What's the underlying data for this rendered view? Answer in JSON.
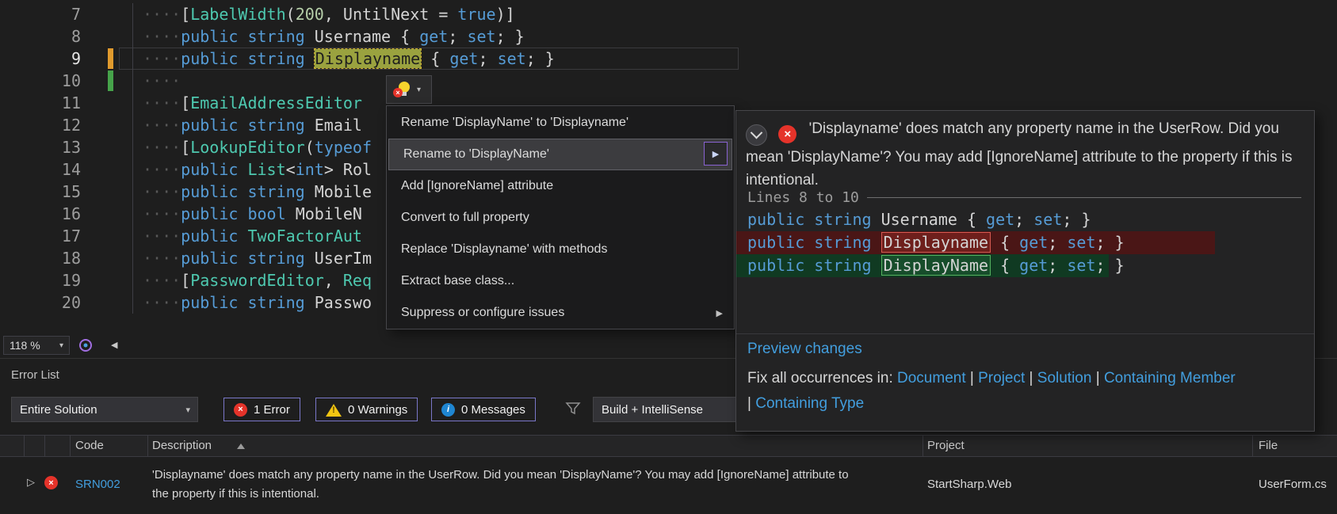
{
  "icons": {
    "dropdown_caret": "▾",
    "submenu_arrow": "▶",
    "scroll_left_arrow": "◀",
    "row_expander": "▷",
    "error_x": "×",
    "warning_mark": "!",
    "info_mark": "i"
  },
  "colors": {
    "accent_link": "#429ede",
    "error_red": "#e5332a",
    "warning_yellow": "#f2c512",
    "info_blue": "#1f86d2",
    "removed_line_bg": "#4a1616",
    "added_line_bg": "#103a22"
  },
  "editor": {
    "zoom_label": "118 %",
    "lines": [
      {
        "num": "7",
        "tokens": [
          [
            "ws",
            "····"
          ],
          [
            "p",
            "["
          ],
          [
            "t",
            "LabelWidth"
          ],
          [
            "p",
            "("
          ],
          [
            "n",
            "200"
          ],
          [
            "p",
            ", "
          ],
          [
            "i",
            "UntilNext"
          ],
          [
            "p",
            " = "
          ],
          [
            "k",
            "true"
          ],
          [
            "p",
            ")]"
          ]
        ]
      },
      {
        "num": "8",
        "tokens": [
          [
            "ws",
            "····"
          ],
          [
            "k",
            "public"
          ],
          [
            "p",
            " "
          ],
          [
            "k",
            "string"
          ],
          [
            "p",
            " "
          ],
          [
            "i",
            "Username"
          ],
          [
            "p",
            " { "
          ],
          [
            "k",
            "get"
          ],
          [
            "p",
            "; "
          ],
          [
            "k",
            "set"
          ],
          [
            "p",
            "; }"
          ]
        ]
      },
      {
        "num": "9",
        "current": true,
        "marker": "modified",
        "tokens": [
          [
            "ws",
            "····"
          ],
          [
            "k",
            "public"
          ],
          [
            "p",
            " "
          ],
          [
            "k",
            "string"
          ],
          [
            "p",
            " "
          ],
          [
            "hl",
            "Displayname"
          ],
          [
            "p",
            " { "
          ],
          [
            "k",
            "get"
          ],
          [
            "p",
            "; "
          ],
          [
            "k",
            "set"
          ],
          [
            "p",
            "; }"
          ]
        ]
      },
      {
        "num": "10",
        "marker": "saved",
        "tokens": [
          [
            "ws",
            "····"
          ]
        ]
      },
      {
        "num": "11",
        "tokens": [
          [
            "ws",
            "····"
          ],
          [
            "p",
            "["
          ],
          [
            "t",
            "EmailAddressEditor"
          ]
        ]
      },
      {
        "num": "12",
        "tokens": [
          [
            "ws",
            "····"
          ],
          [
            "k",
            "public"
          ],
          [
            "p",
            " "
          ],
          [
            "k",
            "string"
          ],
          [
            "p",
            " "
          ],
          [
            "i",
            "Email"
          ]
        ]
      },
      {
        "num": "13",
        "tokens": [
          [
            "ws",
            "····"
          ],
          [
            "p",
            "["
          ],
          [
            "t",
            "LookupEditor"
          ],
          [
            "p",
            "("
          ],
          [
            "k",
            "typeof"
          ]
        ]
      },
      {
        "num": "14",
        "tokens": [
          [
            "ws",
            "····"
          ],
          [
            "k",
            "public"
          ],
          [
            "p",
            " "
          ],
          [
            "t",
            "List"
          ],
          [
            "p",
            "<"
          ],
          [
            "k",
            "int"
          ],
          [
            "p",
            "> "
          ],
          [
            "i",
            "Rol"
          ]
        ]
      },
      {
        "num": "15",
        "tokens": [
          [
            "ws",
            "····"
          ],
          [
            "k",
            "public"
          ],
          [
            "p",
            " "
          ],
          [
            "k",
            "string"
          ],
          [
            "p",
            " "
          ],
          [
            "i",
            "Mobile"
          ]
        ]
      },
      {
        "num": "16",
        "tokens": [
          [
            "ws",
            "····"
          ],
          [
            "k",
            "public"
          ],
          [
            "p",
            " "
          ],
          [
            "k",
            "bool"
          ],
          [
            "p",
            " "
          ],
          [
            "i",
            "MobileN"
          ]
        ]
      },
      {
        "num": "17",
        "tokens": [
          [
            "ws",
            "····"
          ],
          [
            "k",
            "public"
          ],
          [
            "p",
            " "
          ],
          [
            "t",
            "TwoFactorAut"
          ]
        ]
      },
      {
        "num": "18",
        "tokens": [
          [
            "ws",
            "····"
          ],
          [
            "k",
            "public"
          ],
          [
            "p",
            " "
          ],
          [
            "k",
            "string"
          ],
          [
            "p",
            " "
          ],
          [
            "i",
            "UserIm"
          ]
        ]
      },
      {
        "num": "19",
        "tokens": [
          [
            "ws",
            "····"
          ],
          [
            "p",
            "["
          ],
          [
            "t",
            "PasswordEditor"
          ],
          [
            "p",
            ", "
          ],
          [
            "t",
            "Req"
          ]
        ]
      },
      {
        "num": "20",
        "tokens": [
          [
            "ws",
            "····"
          ],
          [
            "k",
            "public"
          ],
          [
            "p",
            " "
          ],
          [
            "k",
            "string"
          ],
          [
            "p",
            " "
          ],
          [
            "i",
            "Passwo"
          ]
        ]
      }
    ]
  },
  "quick_actions": {
    "items": [
      {
        "label": "Rename 'DisplayName' to 'Displayname'"
      },
      {
        "label": "Rename to 'DisplayName'",
        "selected": true,
        "has_preview_arrow": true
      },
      {
        "label": "Add [IgnoreName] attribute"
      },
      {
        "label": "Convert to full property"
      },
      {
        "label": "Replace 'Displayname' with methods"
      },
      {
        "label": "Extract base class..."
      },
      {
        "label": "Suppress or configure issues",
        "has_submenu": true
      }
    ]
  },
  "preview_popup": {
    "message": "'Displayname' does match any property name in the UserRow. Did you mean 'DisplayName'? You may add [IgnoreName] attribute to the property if this is intentional.",
    "lines_label": "Lines 8 to 10",
    "diff": [
      {
        "kind": "context",
        "tokens": [
          [
            "k",
            "public"
          ],
          [
            "p",
            " "
          ],
          [
            "k",
            "string"
          ],
          [
            "p",
            " "
          ],
          [
            "i",
            "Username"
          ],
          [
            "p",
            " { "
          ],
          [
            "k",
            "get"
          ],
          [
            "p",
            "; "
          ],
          [
            "k",
            "set"
          ],
          [
            "p",
            "; }"
          ]
        ]
      },
      {
        "kind": "removed",
        "tokens": [
          [
            "k",
            "public"
          ],
          [
            "p",
            " "
          ],
          [
            "k",
            "string"
          ],
          [
            "p",
            " "
          ],
          [
            "boxr",
            "Displayname"
          ],
          [
            "p",
            " { "
          ],
          [
            "k",
            "get"
          ],
          [
            "p",
            "; "
          ],
          [
            "k",
            "set"
          ],
          [
            "p",
            "; }"
          ]
        ]
      },
      {
        "kind": "added",
        "tokens": [
          [
            "k",
            "public"
          ],
          [
            "p",
            " "
          ],
          [
            "k",
            "string"
          ],
          [
            "p",
            " "
          ],
          [
            "boxg",
            "DisplayName"
          ],
          [
            "p",
            " { "
          ],
          [
            "k",
            "get"
          ],
          [
            "p",
            "; "
          ],
          [
            "k",
            "set"
          ],
          [
            "p",
            "; }"
          ]
        ]
      }
    ],
    "preview_changes_label": "Preview changes",
    "fix_all_label": "Fix all occurrences in:",
    "scopes": [
      "Document",
      "Project",
      "Solution",
      "Containing Member",
      "Containing Type"
    ]
  },
  "error_list": {
    "title": "Error List",
    "scope_filter": "Entire Solution",
    "errors_label": "1 Error",
    "warnings_label": "0 Warnings",
    "messages_label": "0 Messages",
    "source_filter": "Build + IntelliSense",
    "columns": {
      "code": "Code",
      "description": "Description",
      "project": "Project",
      "file": "File"
    },
    "rows": [
      {
        "code": "SRN002",
        "description": "'Displayname' does match any property name in the UserRow. Did you mean 'DisplayName'? You may add [IgnoreName] attribute to the property if this is intentional.",
        "project": "StartSharp.Web",
        "file": "UserForm.cs"
      }
    ]
  }
}
